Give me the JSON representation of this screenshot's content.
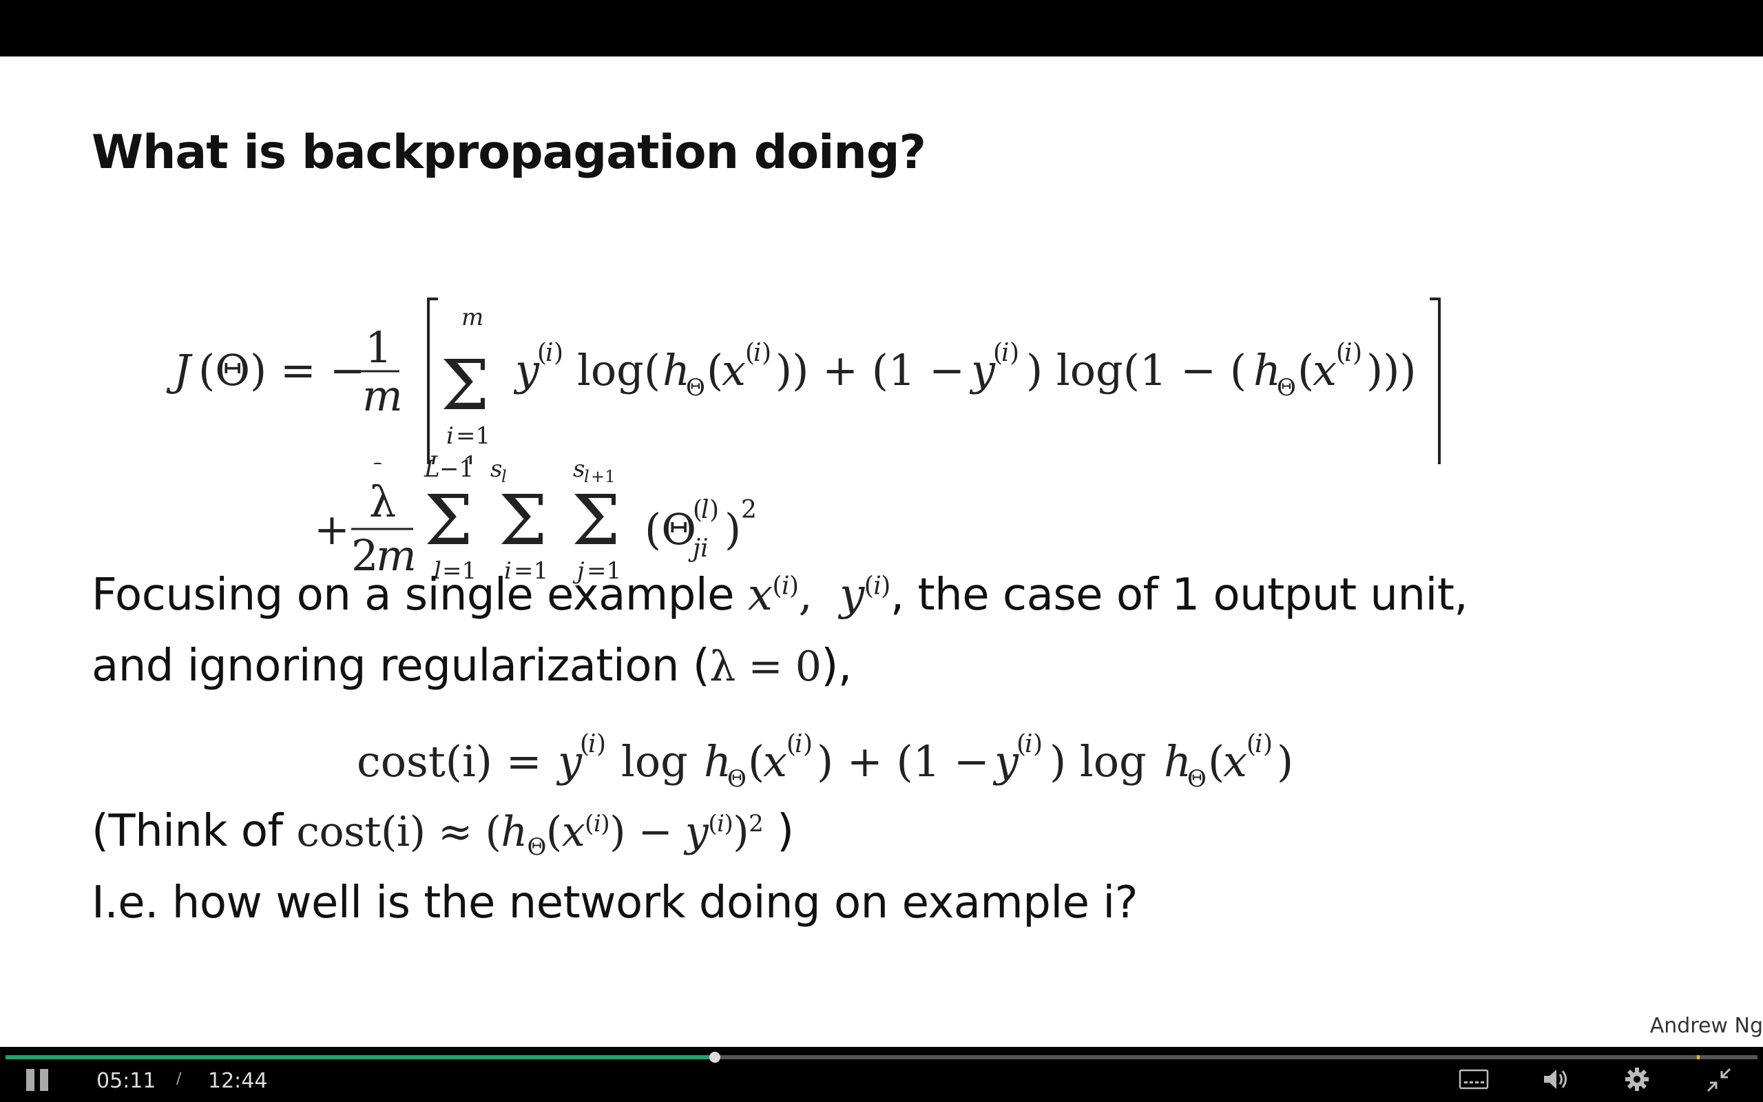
{
  "slide": {
    "title": "What is backpropagation doing?",
    "line1_prefix": "Focusing on a single example",
    "line1_suffix": ", the case of 1 output unit,",
    "line2_prefix": "and ignoring regularization (",
    "line2_suffix": "),",
    "line3_prefix": "(Think of",
    "line3_suffix": ")",
    "line4": "I.e. how well is the network doing on example i?",
    "credit": "Andrew Ng"
  },
  "player": {
    "current_time": "05:11",
    "separator": "/",
    "duration": "12:44",
    "progress_fraction": 0.405,
    "accent_color": "#1fa36f",
    "icons": [
      "pause-icon",
      "captions-icon",
      "volume-icon",
      "settings-icon",
      "exit-fullscreen-icon"
    ]
  }
}
